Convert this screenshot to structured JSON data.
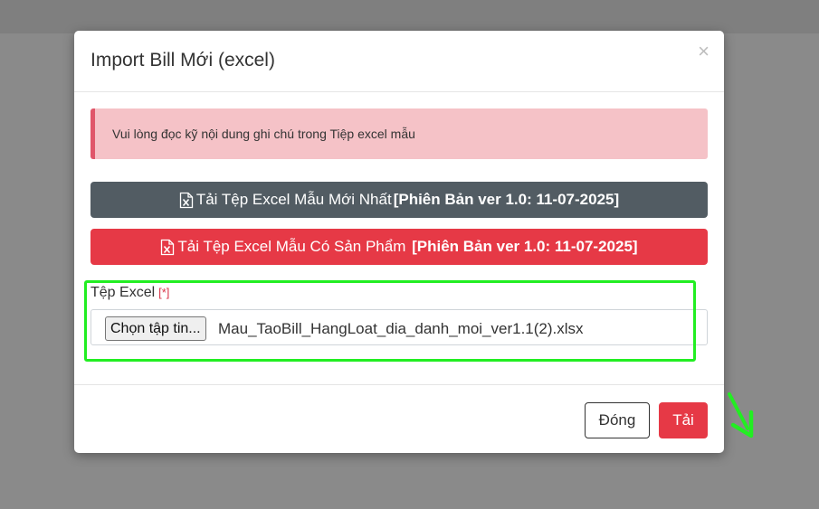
{
  "modal": {
    "title": "Import Bill Mới (excel)",
    "close_glyph": "×"
  },
  "alert": {
    "text": "Vui lòng đọc kỹ nội dung ghi chú trong Tiệp excel mẫu"
  },
  "downloads": {
    "latest": {
      "label": "Tải Tệp Excel Mẫu Mới Nhất",
      "version": "[Phiên Bản ver 1.0: 11-07-2025]",
      "icon": "excel-file-icon",
      "color": "#525c63"
    },
    "with_products": {
      "label": "Tải Tệp Excel Mẫu Có Sản Phẩm ",
      "version": "[Phiên Bản ver 1.0: 11-07-2025]",
      "icon": "excel-file-icon",
      "color": "#e63946"
    }
  },
  "file_field": {
    "label": "Tệp Excel",
    "required_mark": "[*]",
    "button_label": "Chọn tập tin...",
    "file_name": "Mau_TaoBill_HangLoat_dia_danh_moi_ver1.1(2).xlsx"
  },
  "footer": {
    "close_label": "Đóng",
    "submit_label": "Tải"
  },
  "annotation": {
    "highlight_color": "#22ee22"
  }
}
